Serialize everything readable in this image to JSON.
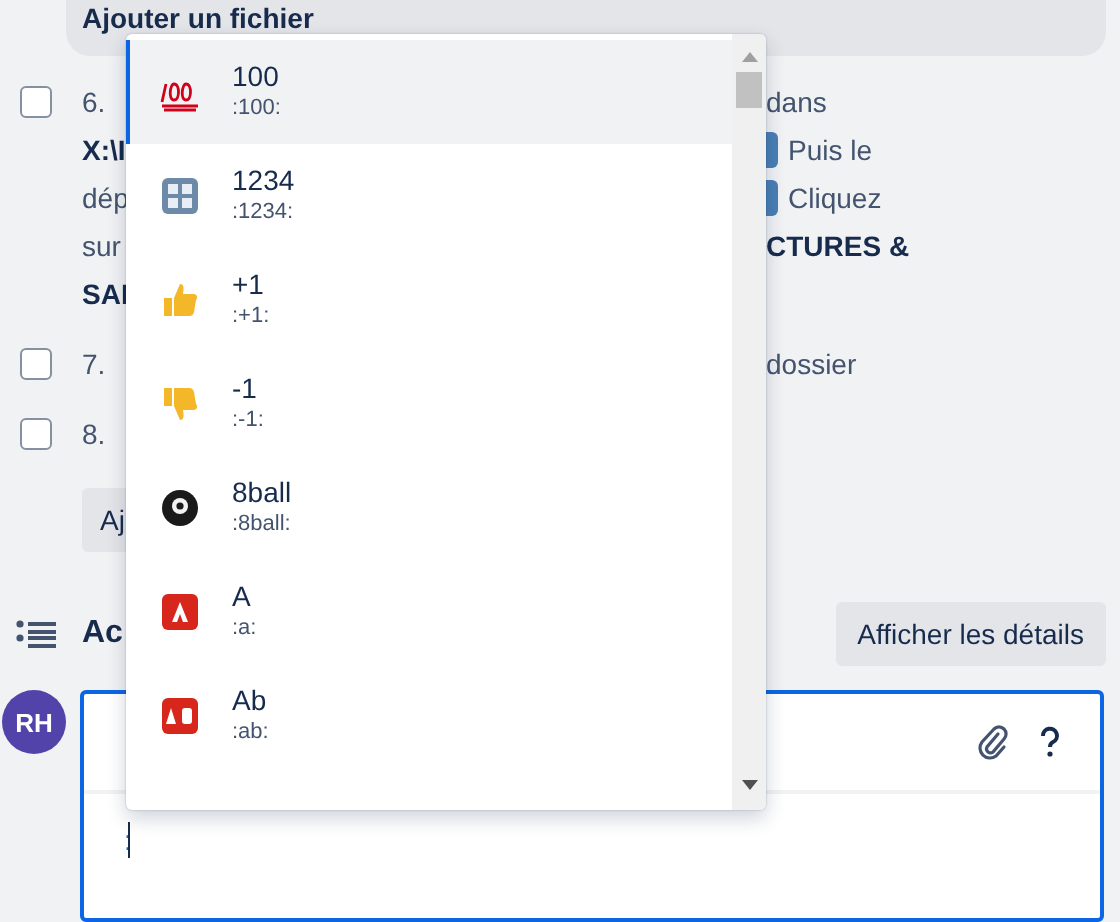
{
  "upload_bar": {
    "label": "Ajouter un fichier"
  },
  "checklist": [
    {
      "checked": false,
      "lines": [
        {
          "left": {
            "text": "6.",
            "bold": false
          },
          "right": {
            "text": "dans",
            "bold": false,
            "icon_before": false
          }
        },
        {
          "left": {
            "text": "X:\\I",
            "bold": true
          },
          "right": {
            "text": "Puis le",
            "bold": false,
            "icon_before": true
          }
        },
        {
          "left": {
            "text": "dép",
            "bold": false
          },
          "right": {
            "text": "Cliquez",
            "bold": false,
            "icon_before": true
          }
        },
        {
          "left": {
            "text": "sur",
            "bold": false
          },
          "right": {
            "text": "CTURES &",
            "bold": true,
            "icon_before": false
          }
        },
        {
          "left": {
            "text": "SAI",
            "bold": true
          }
        }
      ]
    },
    {
      "checked": false,
      "lines": [
        {
          "left": {
            "text": "7.",
            "bold": false
          },
          "right": {
            "text": "dossier",
            "bold": false,
            "icon_before": false
          }
        }
      ]
    },
    {
      "checked": false,
      "lines": [
        {
          "left": {
            "text": "8.",
            "bold": false
          }
        }
      ]
    }
  ],
  "add_button": {
    "label": "Aj"
  },
  "activity": {
    "title": "Ac",
    "details_button": "Afficher les détails"
  },
  "comment": {
    "avatar": "RH",
    "value": ":"
  },
  "emoji_menu": [
    {
      "kind": "hundred",
      "name": "100",
      "code": ":100:",
      "selected": true
    },
    {
      "kind": "numbers",
      "name": "1234",
      "code": ":1234:",
      "selected": false
    },
    {
      "kind": "thumbs_up",
      "name": "+1",
      "code": ":+1:",
      "selected": false
    },
    {
      "kind": "thumbs_down",
      "name": "-1",
      "code": ":-1:",
      "selected": false
    },
    {
      "kind": "ball",
      "name": "8ball",
      "code": ":8ball:",
      "selected": false
    },
    {
      "kind": "letter_a",
      "name": "A",
      "code": ":a:",
      "selected": false
    },
    {
      "kind": "letters_ab",
      "name": "Ab",
      "code": ":ab:",
      "selected": false
    }
  ]
}
